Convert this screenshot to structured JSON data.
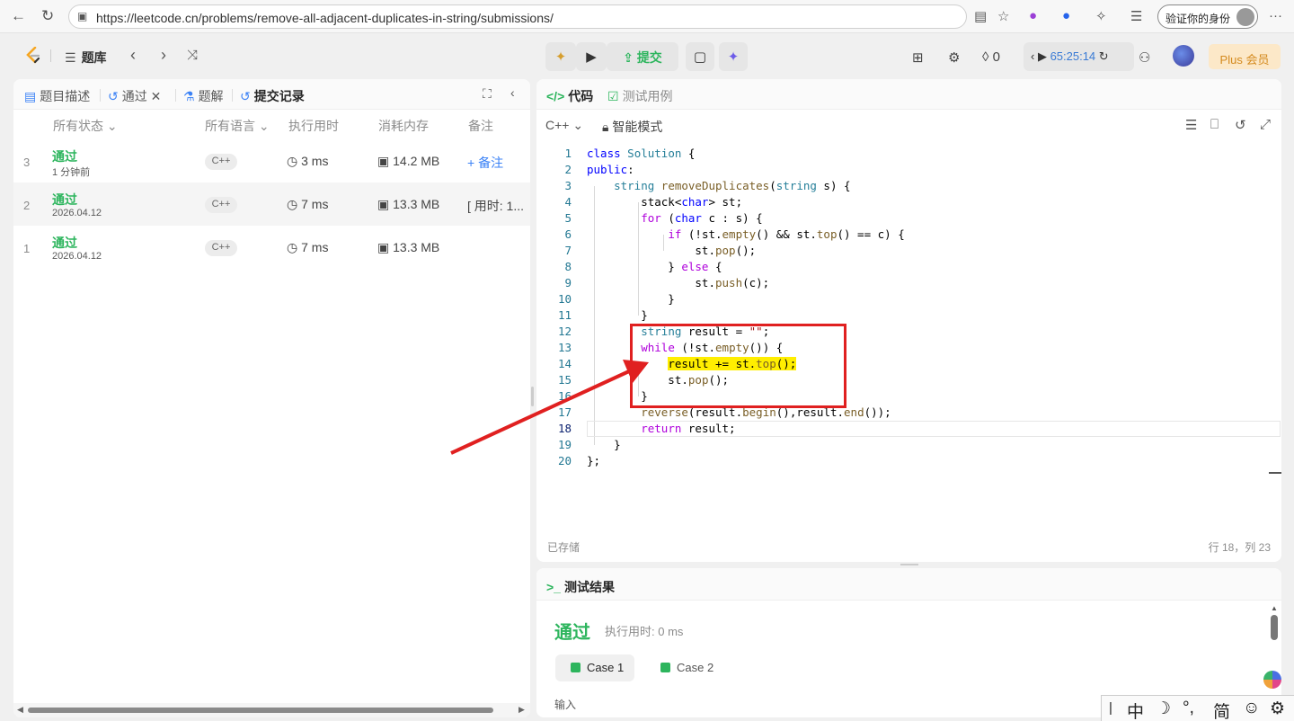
{
  "browser": {
    "url": "https://leetcode.cn/problems/remove-all-adjacent-duplicates-in-string/submissions/",
    "verify_label": "验证你的身份"
  },
  "nav": {
    "problem_bank": "题库",
    "submit_label": "提交",
    "streak": "0",
    "timer": "65:25:14",
    "plus_label": "Plus 会员"
  },
  "left_tabs": {
    "description": "题目描述",
    "passed": "通过",
    "solution": "题解",
    "submissions": "提交记录"
  },
  "columns": {
    "status": "所有状态",
    "language": "所有语言",
    "runtime": "执行用时",
    "memory": "消耗内存",
    "note": "备注"
  },
  "submissions": [
    {
      "index": "3",
      "status": "通过",
      "when": "1 分钟前",
      "lang": "C++",
      "runtime": "3 ms",
      "memory": "14.2 MB",
      "note": "+ 备注"
    },
    {
      "index": "2",
      "status": "通过",
      "when": "2026.04.12",
      "lang": "C++",
      "runtime": "7 ms",
      "memory": "13.3 MB",
      "note": "[ 用时: 1..."
    },
    {
      "index": "1",
      "status": "通过",
      "when": "2026.04.12",
      "lang": "C++",
      "runtime": "7 ms",
      "memory": "13.3 MB",
      "note": ""
    }
  ],
  "code_tabs": {
    "code": "代码",
    "testcase": "测试用例"
  },
  "editor": {
    "language": "C++",
    "mode": "智能模式",
    "saved": "已存储",
    "cursor": "行 18，列 23"
  },
  "test_result": {
    "title": "测试结果",
    "status": "通过",
    "exec_time": "执行用时: 0 ms",
    "case1": "Case 1",
    "case2": "Case 2",
    "input_label": "输入"
  },
  "ime": {
    "mode": "中",
    "punct": "°,",
    "script": "简"
  },
  "colors": {
    "accepted_green": "#2db55d",
    "annotation_red": "#e02020",
    "highlight_yellow": "#ffee00",
    "link_blue": "#3b82f6"
  }
}
